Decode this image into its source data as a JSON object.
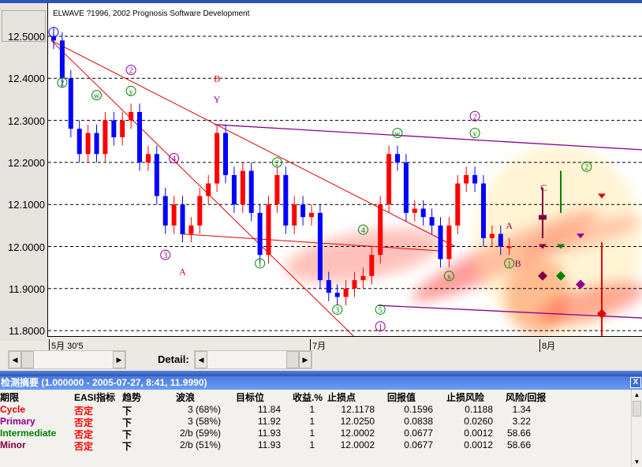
{
  "app": {
    "copyright": "ELWAVE ?1996, 2002 Prognosis Software Development"
  },
  "y_axis": {
    "labels": [
      "12.5000",
      "12.4000",
      "12.3000",
      "12.2000",
      "12.1000",
      "12.0000",
      "11.9000",
      "11.8000"
    ]
  },
  "x_axis": {
    "labels": [
      "5月 30'5",
      "7月",
      "8月"
    ]
  },
  "scrollbar": {
    "detail_label": "Detail:"
  },
  "panel": {
    "title": "检测摘要 (1.000000 - 2005-07-27, 8:41, 11.9990)",
    "close": "X",
    "headers": [
      "期限",
      "EASI指标",
      "趋势",
      "波浪",
      "目标位",
      "收益.%",
      "止损点",
      "回报值",
      "止损风险",
      "风险/回报"
    ],
    "rows": [
      {
        "degree": "Cycle",
        "color": "#e00000",
        "easi": "否定",
        "trend": "下",
        "wave": "3 (68%)",
        "target": "11.84",
        "gain": "1",
        "stop": "12.1178",
        "reward": "0.1596",
        "risk": "0.1188",
        "ratio": "1.34"
      },
      {
        "degree": "Primary",
        "color": "#8b008b",
        "easi": "否定",
        "trend": "下",
        "wave": "3 (58%)",
        "target": "11.92",
        "gain": "1",
        "stop": "12.0250",
        "reward": "0.0838",
        "risk": "0.0260",
        "ratio": "3.22"
      },
      {
        "degree": "Intermediate",
        "color": "#008000",
        "easi": "否定",
        "trend": "下",
        "wave": "2/b (59%)",
        "target": "11.93",
        "gain": "1",
        "stop": "12.0002",
        "reward": "0.0677",
        "risk": "0.0012",
        "ratio": "58.66"
      },
      {
        "degree": "Minor",
        "color": "#800040",
        "easi": "否定",
        "trend": "下",
        "wave": "2/b (51%)",
        "target": "11.93",
        "gain": "1",
        "stop": "12.0002",
        "reward": "0.0677",
        "risk": "0.0012",
        "ratio": "58.66"
      }
    ]
  },
  "chart_data": {
    "type": "candlestick",
    "ylim": [
      11.78,
      12.54
    ],
    "closes": [
      12.49,
      12.4,
      12.28,
      12.22,
      12.27,
      12.22,
      12.3,
      12.26,
      12.3,
      12.32,
      12.2,
      12.22,
      12.12,
      12.05,
      12.1,
      12.03,
      12.05,
      12.12,
      12.15,
      12.27,
      12.17,
      12.1,
      12.18,
      12.08,
      11.98,
      12.1,
      12.17,
      12.05,
      12.1,
      12.07,
      12.08,
      11.92,
      11.89,
      11.88,
      11.9,
      11.92,
      11.93,
      11.98,
      12.1,
      12.22,
      12.2,
      12.08,
      12.09,
      12.07,
      12.05,
      11.97,
      12.05,
      12.15,
      12.17,
      12.15,
      12.02,
      12.03,
      12.0,
      12.0
    ],
    "up_color": "#ff0000",
    "down_color": "#0000ff",
    "wave_labels": [
      {
        "t": "I",
        "i": 0,
        "p": 12.51,
        "c": "#0000ff"
      },
      {
        "t": "2",
        "i": 1,
        "p": 12.39,
        "c": "#008000"
      },
      {
        "t": "w",
        "i": 5,
        "p": 12.36,
        "c": "#008000"
      },
      {
        "t": "2",
        "i": 9,
        "p": 12.42,
        "c": "#8b008b"
      },
      {
        "t": "y",
        "i": 9,
        "p": 12.37,
        "c": "#008000"
      },
      {
        "t": "B",
        "i": 19,
        "p": 12.4,
        "c": "#e00000"
      },
      {
        "t": "Y",
        "i": 19,
        "p": 12.35,
        "c": "#8b008b"
      },
      {
        "t": "4",
        "i": 14,
        "p": 12.21,
        "c": "#8b008b"
      },
      {
        "t": "3",
        "i": 13,
        "p": 11.98,
        "c": "#8b008b"
      },
      {
        "t": "A",
        "i": 15,
        "p": 11.94,
        "c": "#e00000"
      },
      {
        "t": "1",
        "i": 24,
        "p": 11.96,
        "c": "#008000"
      },
      {
        "t": "2",
        "i": 26,
        "p": 12.2,
        "c": "#008000"
      },
      {
        "t": "4",
        "i": 36,
        "p": 12.04,
        "c": "#008000"
      },
      {
        "t": "5",
        "i": 38,
        "p": 11.85,
        "c": "#008000"
      },
      {
        "t": "3",
        "i": 33,
        "p": 11.85,
        "c": "#008000"
      },
      {
        "t": "1",
        "i": 38,
        "p": 11.81,
        "c": "#8b008b"
      },
      {
        "t": "w",
        "i": 40,
        "p": 12.27,
        "c": "#008000"
      },
      {
        "t": "x",
        "i": 46,
        "p": 11.93,
        "c": "#008000"
      },
      {
        "t": "2",
        "i": 49,
        "p": 12.31,
        "c": "#8b008b"
      },
      {
        "t": "y",
        "i": 49,
        "p": 12.27,
        "c": "#008000"
      },
      {
        "t": "A",
        "i": 53,
        "p": 12.05,
        "c": "#800040"
      },
      {
        "t": "1",
        "i": 53,
        "p": 11.96,
        "c": "#008000"
      },
      {
        "t": "B",
        "i": 54,
        "p": 11.96,
        "c": "#800040"
      },
      {
        "t": "C",
        "i": 57,
        "p": 12.14,
        "c": "#800040"
      },
      {
        "t": "2",
        "i": 62,
        "p": 12.19,
        "c": "#008000"
      }
    ]
  }
}
